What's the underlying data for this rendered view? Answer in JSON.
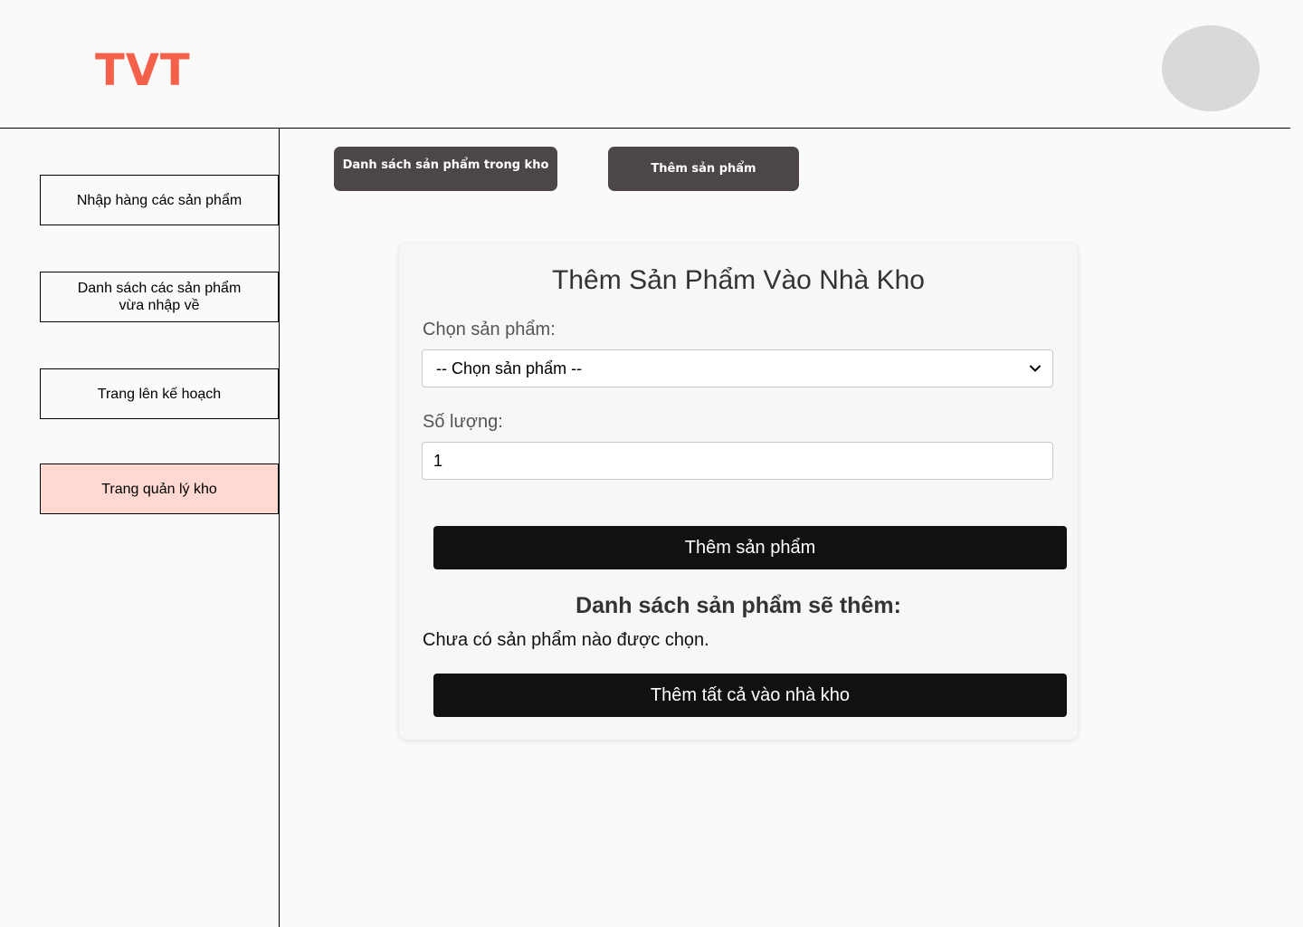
{
  "header": {
    "logo_text": "TVT",
    "brand_color": "#f4604a"
  },
  "sidebar": {
    "items": [
      {
        "label": "Nhập hàng các sản phẩm",
        "active": false
      },
      {
        "label": "Danh sách các sản phẩm vừa nhập về",
        "active": false
      },
      {
        "label": "Trang lên kế hoạch",
        "active": false
      },
      {
        "label": "Trang quản lý kho",
        "active": true
      }
    ],
    "active_color": "#ffd9d1"
  },
  "top_tabs": {
    "list_label": "Danh sách sản phẩm trong kho",
    "add_label": "Thêm sản phẩm"
  },
  "form": {
    "title": "Thêm Sản Phẩm Vào Nhà Kho",
    "product_label": "Chọn sản phẩm:",
    "product_selected": "-- Chọn sản phẩm --",
    "quantity_label": "Số lượng:",
    "quantity_value": "1",
    "add_button": "Thêm sản phẩm",
    "pending_title": "Danh sách sản phẩm sẽ thêm:",
    "pending_empty": "Chưa có sản phẩm nào được chọn.",
    "submit_all_button": "Thêm tất cả vào nhà kho"
  }
}
